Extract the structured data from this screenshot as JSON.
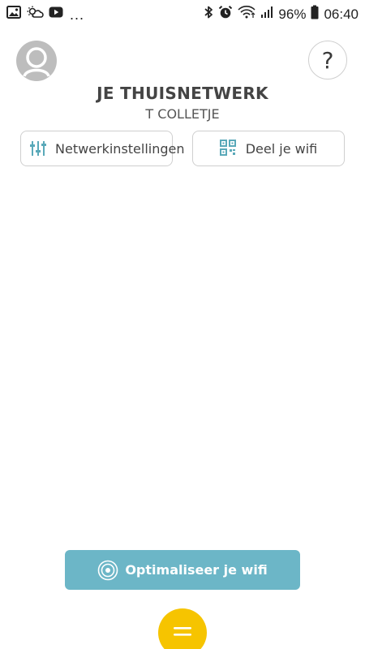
{
  "status_bar": {
    "battery": "96%",
    "time": "06:40",
    "overflow": "..."
  },
  "header": {
    "title": "JE THUISNETWERK",
    "subtitle": "T COLLETJE",
    "help_label": "?"
  },
  "actions": {
    "network_settings_label": "Netwerkinstellingen",
    "share_wifi_label": "Deel je wifi"
  },
  "optimize": {
    "label": "Optimaliseer je wifi"
  },
  "colors": {
    "accent": "#6cb6c7",
    "fab": "#f6c400",
    "icon_teal": "#5aa9b9"
  },
  "icons": {
    "status_left": [
      "image-icon",
      "weather-icon",
      "youtube-icon"
    ],
    "status_right": [
      "bluetooth-icon",
      "alarm-icon",
      "wifi-icon",
      "signal-icon",
      "battery-icon"
    ],
    "network_settings": "sliders-icon",
    "share_wifi": "qr-code-icon",
    "optimize": "wifi-radar-icon",
    "fab": "menu-icon"
  }
}
